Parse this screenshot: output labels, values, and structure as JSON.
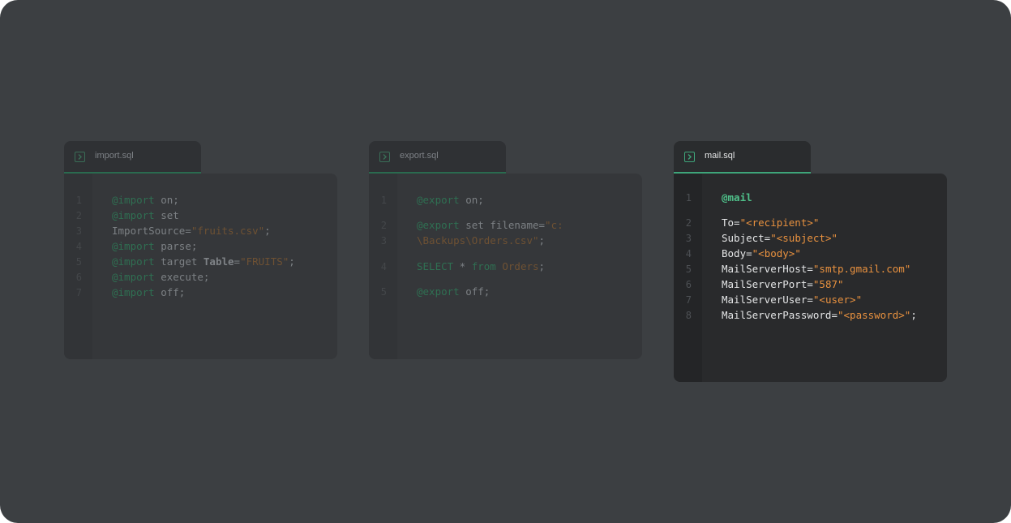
{
  "panels": [
    {
      "file": "import.sql",
      "lines": [
        {
          "n": "1",
          "parts": [
            {
              "t": "@import",
              "c": "kw"
            },
            {
              "t": " on;",
              "c": "txt"
            }
          ]
        },
        {
          "n": "2",
          "parts": [
            {
              "t": "@import",
              "c": "kw"
            },
            {
              "t": " set",
              "c": "txt"
            }
          ]
        },
        {
          "n": "3",
          "parts": [
            {
              "t": "ImportSource=",
              "c": "txt"
            },
            {
              "t": "\"fruits.csv\"",
              "c": "str"
            },
            {
              "t": ";",
              "c": "txt"
            }
          ]
        },
        {
          "n": "4",
          "parts": [
            {
              "t": "@import",
              "c": "kw"
            },
            {
              "t": " parse;",
              "c": "txt"
            }
          ]
        },
        {
          "n": "5",
          "parts": [
            {
              "t": "@import",
              "c": "kw"
            },
            {
              "t": " target ",
              "c": "txt"
            },
            {
              "t": "Table",
              "c": "bold"
            },
            {
              "t": "=",
              "c": "txt"
            },
            {
              "t": "\"FRUITS\"",
              "c": "str"
            },
            {
              "t": ";",
              "c": "txt"
            }
          ]
        },
        {
          "n": "6",
          "parts": [
            {
              "t": "@import",
              "c": "kw"
            },
            {
              "t": " execute;",
              "c": "txt"
            }
          ]
        },
        {
          "n": "7",
          "parts": [
            {
              "t": "@import",
              "c": "kw"
            },
            {
              "t": " off;",
              "c": "txt"
            }
          ]
        }
      ]
    },
    {
      "file": "export.sql",
      "lines": [
        {
          "n": "1",
          "parts": [
            {
              "t": "@export",
              "c": "kw"
            },
            {
              "t": " on;",
              "c": "txt"
            }
          ]
        },
        {
          "n": "2",
          "parts": [
            {
              "t": "@export",
              "c": "kw"
            },
            {
              "t": " set filename=",
              "c": "txt"
            },
            {
              "t": "\"c:",
              "c": "str"
            }
          ]
        },
        {
          "n": "3",
          "parts": [
            {
              "t": "\\Backups\\Orders.csv\"",
              "c": "str"
            },
            {
              "t": ";",
              "c": "txt"
            }
          ]
        },
        {
          "n": "4",
          "parts": [
            {
              "t": "SELECT",
              "c": "kw"
            },
            {
              "t": " * ",
              "c": "txt"
            },
            {
              "t": "from",
              "c": "kw"
            },
            {
              "t": " ",
              "c": "txt"
            },
            {
              "t": "Orders",
              "c": "str"
            },
            {
              "t": ";",
              "c": "txt"
            }
          ]
        },
        {
          "n": "5",
          "parts": [
            {
              "t": "@export",
              "c": "kw"
            },
            {
              "t": " off;",
              "c": "txt"
            }
          ]
        }
      ]
    },
    {
      "file": "mail.sql",
      "lines": [
        {
          "n": "1",
          "parts": [
            {
              "t": "@mail",
              "c": "kw"
            }
          ]
        },
        {
          "n": "2",
          "parts": [
            {
              "t": "To=",
              "c": "txt"
            },
            {
              "t": "\"<recipient>\"",
              "c": "str"
            }
          ]
        },
        {
          "n": "3",
          "parts": [
            {
              "t": "Subject=",
              "c": "txt"
            },
            {
              "t": "\"<subject>\"",
              "c": "str"
            }
          ]
        },
        {
          "n": "4",
          "parts": [
            {
              "t": "Body=",
              "c": "txt"
            },
            {
              "t": "\"<body>\"",
              "c": "str"
            }
          ]
        },
        {
          "n": "5",
          "parts": [
            {
              "t": "MailServerHost=",
              "c": "txt"
            },
            {
              "t": "\"smtp.gmail.com\"",
              "c": "str"
            }
          ]
        },
        {
          "n": "6",
          "parts": [
            {
              "t": "MailServerPort=",
              "c": "txt"
            },
            {
              "t": "\"587\"",
              "c": "str"
            }
          ]
        },
        {
          "n": "7",
          "parts": [
            {
              "t": "MailServerUser=",
              "c": "txt"
            },
            {
              "t": "\"<user>\"",
              "c": "str"
            }
          ]
        },
        {
          "n": "8",
          "parts": [
            {
              "t": "MailServerPassword=",
              "c": "txt"
            },
            {
              "t": "\"<password>\"",
              "c": "str"
            },
            {
              "t": ";",
              "c": "txt"
            }
          ]
        }
      ]
    }
  ],
  "colors": {
    "background": "#3c3f42",
    "accent": "#3ea57a",
    "string": "#e8913f"
  },
  "icons": {
    "tab_icon": "terminal-icon"
  }
}
